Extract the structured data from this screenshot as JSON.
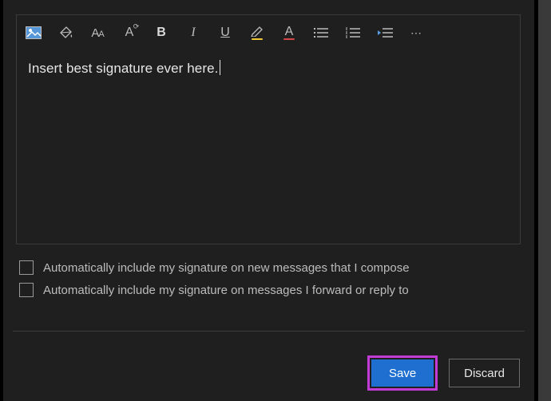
{
  "toolbar": {
    "image_icon": "insert-image",
    "paint_icon": "paint-bucket",
    "font_size": "AA",
    "font_size_reset": "A",
    "bold": "B",
    "italic": "I",
    "underline": "U",
    "highlight": "A",
    "font_color": "A",
    "bulleted_list": "bulleted-list",
    "numbered_list": "numbered-list",
    "outdent": "decrease-indent",
    "more": "⋯",
    "highlight_bar_color": "#f0c735",
    "font_color_bar_color": "#d64848"
  },
  "editor": {
    "text": "Insert best signature ever here."
  },
  "options": {
    "new_messages": "Automatically include my signature on new messages that I compose",
    "reply_forward": "Automatically include my signature on messages I forward or reply to",
    "new_messages_checked": false,
    "reply_forward_checked": false
  },
  "footer": {
    "save": "Save",
    "discard": "Discard"
  }
}
